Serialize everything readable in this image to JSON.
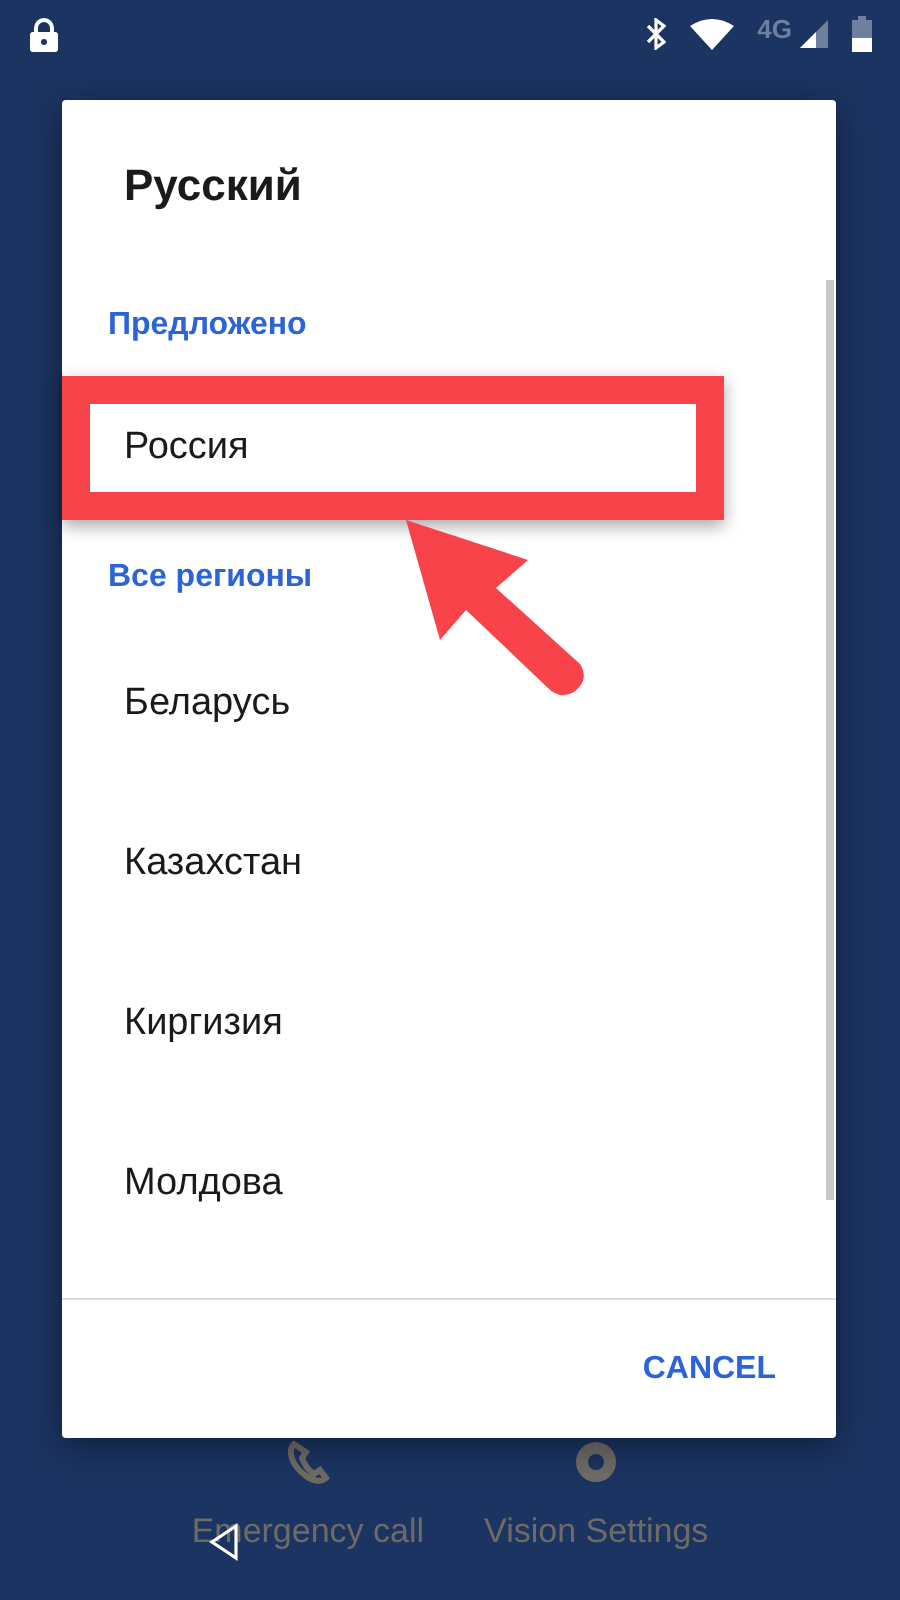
{
  "status_bar": {
    "network": "4G"
  },
  "dialog": {
    "title": "Русский",
    "sections": [
      {
        "heading": "Предложено",
        "items": [
          {
            "label": "Россия",
            "highlighted": true
          }
        ]
      },
      {
        "heading": "Все регионы",
        "items": [
          {
            "label": "Беларусь",
            "highlighted": false
          },
          {
            "label": "Казахстан",
            "highlighted": false
          },
          {
            "label": "Киргизия",
            "highlighted": false
          },
          {
            "label": "Молдова",
            "highlighted": false
          }
        ]
      }
    ],
    "buttons": [
      "CANCEL"
    ]
  },
  "lock_actions": [
    {
      "kind": "phone",
      "label": "Emergency call"
    },
    {
      "kind": "eye",
      "label": "Vision Settings"
    }
  ]
}
